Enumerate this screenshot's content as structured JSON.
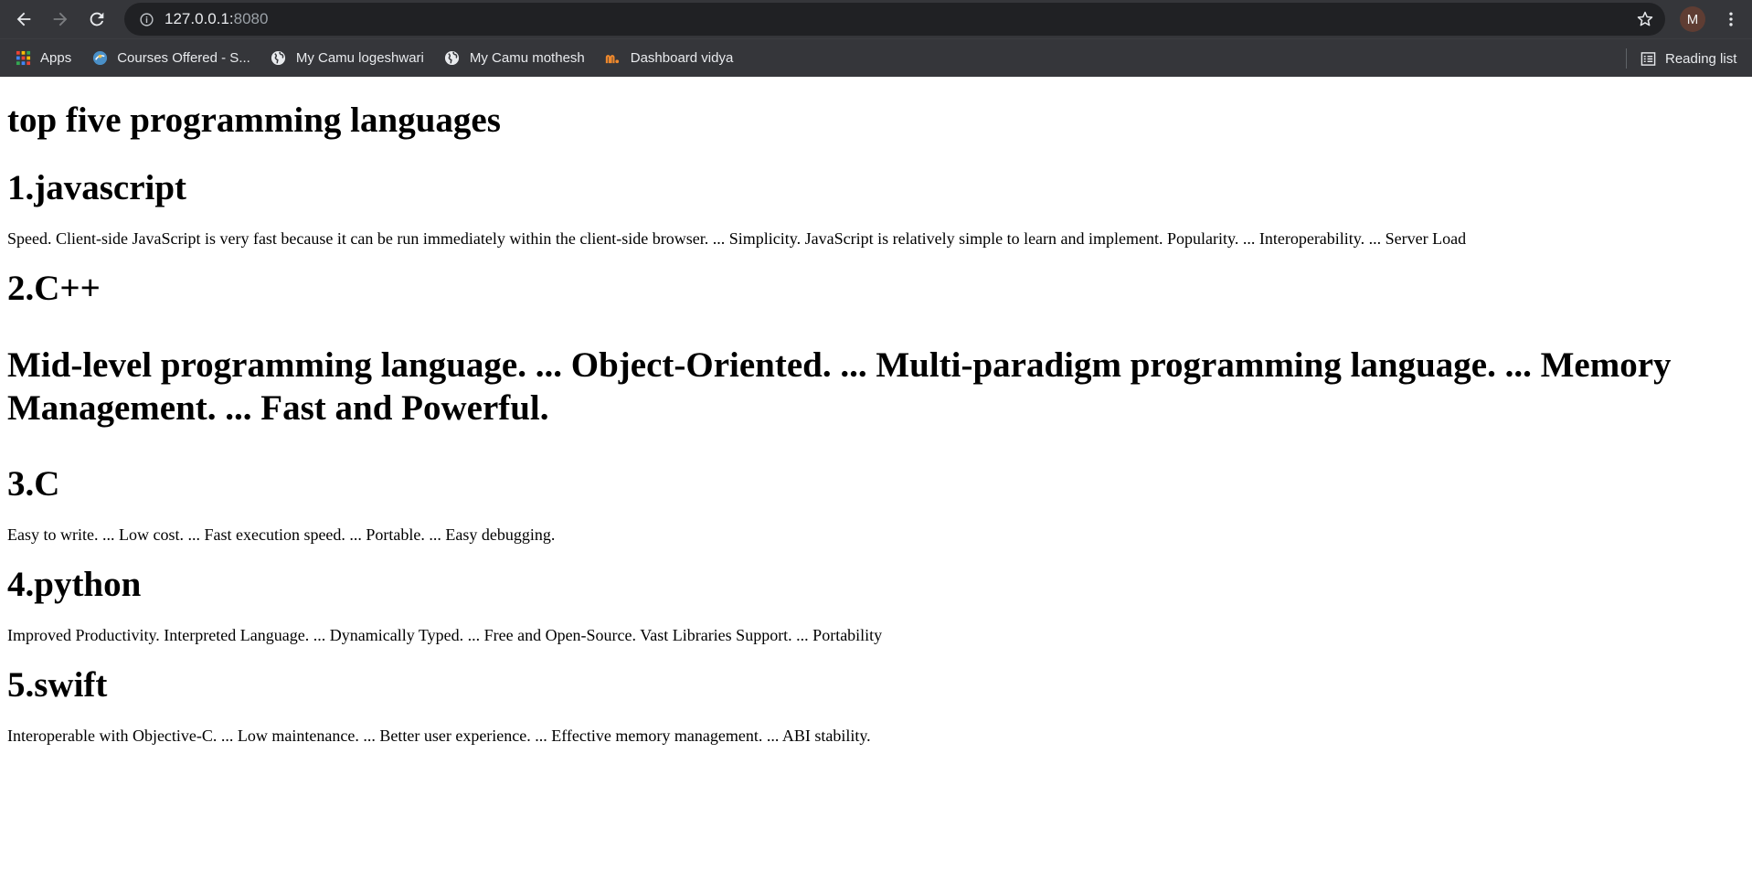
{
  "browser": {
    "url_host": "127.0.0.1:",
    "url_port": "8080",
    "avatar_initial": "M",
    "bookmarks": [
      {
        "label": "Apps",
        "icon": "apps-grid-icon"
      },
      {
        "label": "Courses Offered - S...",
        "icon": "site-favicon-icon"
      },
      {
        "label": "My Camu logeshwari",
        "icon": "globe-icon"
      },
      {
        "label": "My Camu mothesh",
        "icon": "globe-icon"
      },
      {
        "label": "Dashboard vidya",
        "icon": "dashboard-favicon-icon"
      }
    ],
    "reading_list": "Reading list"
  },
  "page": {
    "title": "top five programming languages",
    "sections": [
      {
        "heading": "1.javascript",
        "description": "Speed. Client-side JavaScript is very fast because it can be run immediately within the client-side browser. ... Simplicity. JavaScript is relatively simple to learn and implement. Popularity. ... Interoperability. ... Server Load"
      },
      {
        "heading": "2.C++",
        "description": "Mid-level programming language. ... Object-Oriented. ... Multi-paradigm programming language. ... Memory Management. ... Fast and Powerful."
      },
      {
        "heading": "3.C",
        "description": "Easy to write. ... Low cost. ... Fast execution speed. ... Portable. ... Easy debugging."
      },
      {
        "heading": "4.python",
        "description": "Improved Productivity. Interpreted Language. ... Dynamically Typed. ... Free and Open-Source. Vast Libraries Support. ... Portability"
      },
      {
        "heading": "5.swift",
        "description": "Interoperable with Objective-C. ... Low maintenance. ... Better user experience. ... Effective memory management. ... ABI stability."
      }
    ]
  },
  "colors": {
    "chrome_bg": "#35363a",
    "omnibox_bg": "#202124",
    "page_bg": "#ffffff",
    "text": "#000000"
  }
}
